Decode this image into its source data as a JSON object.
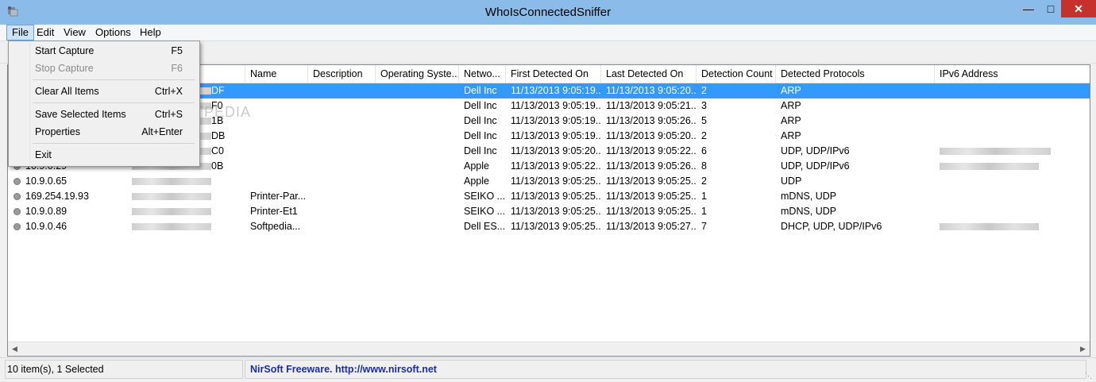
{
  "window": {
    "title": "WhoIsConnectedSniffer",
    "min_icon": "minimize-icon",
    "max_icon": "maximize-icon",
    "close_icon": "close-icon",
    "close_color": "#c7312b"
  },
  "menubar": [
    "File",
    "Edit",
    "View",
    "Options",
    "Help"
  ],
  "file_menu": {
    "items": [
      {
        "label": "Start Capture",
        "shortcut": "F5",
        "enabled": true
      },
      {
        "label": "Stop Capture",
        "shortcut": "F6",
        "enabled": false
      },
      {
        "label": "Clear All Items",
        "shortcut": "Ctrl+X",
        "enabled": true
      },
      {
        "label": "Save Selected Items",
        "shortcut": "Ctrl+S",
        "enabled": true
      },
      {
        "label": "Properties",
        "shortcut": "Alt+Enter",
        "enabled": true
      },
      {
        "label": "Exit",
        "shortcut": "",
        "enabled": true
      }
    ]
  },
  "columns": [
    "Name",
    "Description",
    "Operating Syste...",
    "Netwo...",
    "First Detected On",
    "Last Detected On",
    "Detection Count",
    "Detected Protocols",
    "IPv6 Address"
  ],
  "rows": [
    {
      "ip": "",
      "mac_tail": "DF",
      "name": "",
      "description": "",
      "os": "",
      "network": "Dell Inc",
      "first": "11/13/2013 9:05:19...",
      "last": "11/13/2013 9:05:20...",
      "count": "2",
      "protocols": "ARP",
      "ipv6": false,
      "selected": true
    },
    {
      "ip": "",
      "mac_tail": "F0",
      "name": "",
      "description": "",
      "os": "",
      "network": "Dell Inc",
      "first": "11/13/2013 9:05:19...",
      "last": "11/13/2013 9:05:21...",
      "count": "3",
      "protocols": "ARP",
      "ipv6": false,
      "selected": false
    },
    {
      "ip": "",
      "mac_tail": "1B",
      "name": "",
      "description": "",
      "os": "",
      "network": "Dell Inc",
      "first": "11/13/2013 9:05:19...",
      "last": "11/13/2013 9:05:26...",
      "count": "5",
      "protocols": "ARP",
      "ipv6": false,
      "selected": false
    },
    {
      "ip": "",
      "mac_tail": "DB",
      "name": "",
      "description": "",
      "os": "",
      "network": "Dell Inc",
      "first": "11/13/2013 9:05:19...",
      "last": "11/13/2013 9:05:20...",
      "count": "2",
      "protocols": "ARP",
      "ipv6": false,
      "selected": false
    },
    {
      "ip": "",
      "mac_tail": "C0",
      "name": "",
      "description": "",
      "os": "",
      "network": "Dell Inc",
      "first": "11/13/2013 9:05:20...",
      "last": "11/13/2013 9:05:22...",
      "count": "6",
      "protocols": "UDP, UDP/IPv6",
      "ipv6": true,
      "selected": false
    },
    {
      "ip": "10.9.0.29",
      "mac_tail": "0B",
      "name": "",
      "description": "",
      "os": "",
      "network": "Apple",
      "first": "11/13/2013 9:05:22...",
      "last": "11/13/2013 9:05:26...",
      "count": "8",
      "protocols": "UDP, UDP/IPv6",
      "ipv6": true,
      "selected": false
    },
    {
      "ip": "10.9.0.65",
      "mac_tail": "",
      "name": "",
      "description": "",
      "os": "",
      "network": "Apple",
      "first": "11/13/2013 9:05:25...",
      "last": "11/13/2013 9:05:25...",
      "count": "2",
      "protocols": "UDP",
      "ipv6": false,
      "selected": false
    },
    {
      "ip": "169.254.19.93",
      "mac_tail": "",
      "name": "Printer-Par...",
      "description": "",
      "os": "",
      "network": "SEIKO ...",
      "first": "11/13/2013 9:05:25...",
      "last": "11/13/2013 9:05:25...",
      "count": "1",
      "protocols": "mDNS, UDP",
      "ipv6": false,
      "selected": false
    },
    {
      "ip": "10.9.0.89",
      "mac_tail": "",
      "name": "Printer-Et1",
      "description": "",
      "os": "",
      "network": "SEIKO ...",
      "first": "11/13/2013 9:05:25...",
      "last": "11/13/2013 9:05:25...",
      "count": "1",
      "protocols": "mDNS, UDP",
      "ipv6": false,
      "selected": false
    },
    {
      "ip": "10.9.0.46",
      "mac_tail": "",
      "name": "Softpedia...",
      "description": "",
      "os": "",
      "network": "Dell ES...",
      "first": "11/13/2013 9:05:25...",
      "last": "11/13/2013 9:05:27...",
      "count": "7",
      "protocols": "DHCP, UDP, UDP/IPv6",
      "ipv6": true,
      "selected": false
    }
  ],
  "status": {
    "count": "10 item(s), 1 Selected",
    "link": "NirSoft Freeware.  http://www.nirsoft.net",
    "link_color": "#1a2ea6"
  },
  "watermark": "SOFTPEDIA",
  "selection_color": "#3399ff"
}
